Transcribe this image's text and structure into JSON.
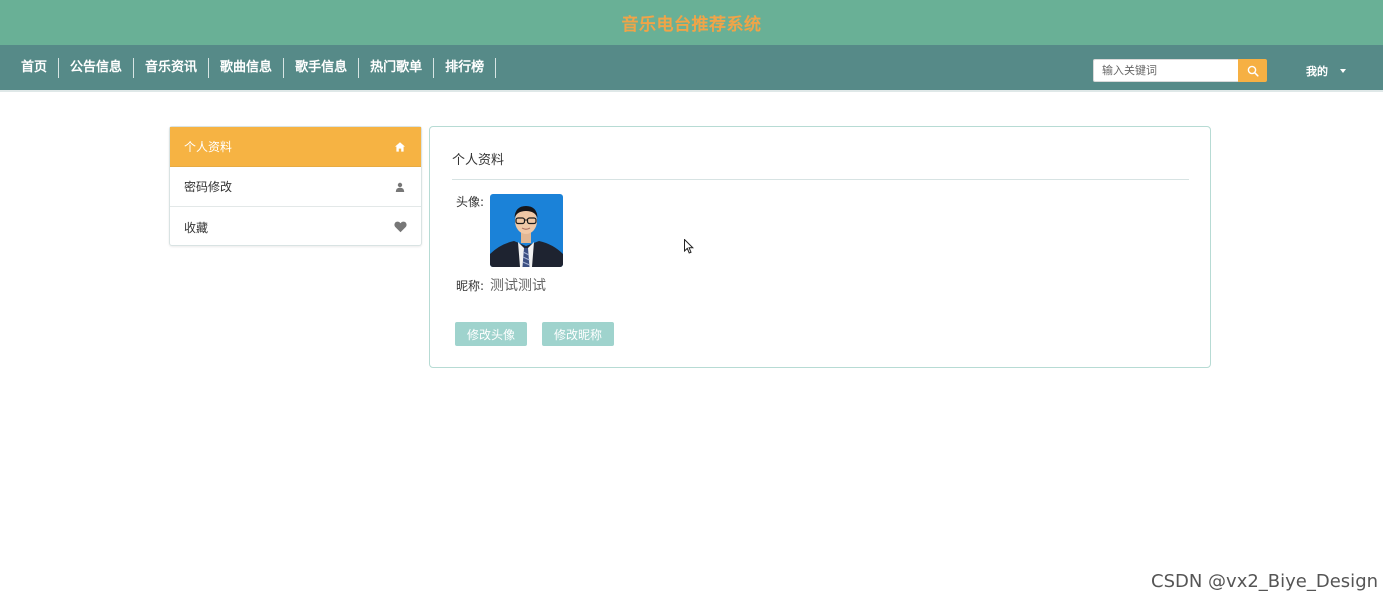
{
  "header": {
    "title": "音乐电台推荐系统",
    "title_color": "#f0a448",
    "bg_color": "#69b096"
  },
  "nav": {
    "items": [
      {
        "label": "首页"
      },
      {
        "label": "公告信息"
      },
      {
        "label": "音乐资讯"
      },
      {
        "label": "歌曲信息"
      },
      {
        "label": "歌手信息"
      },
      {
        "label": "热门歌单"
      },
      {
        "label": "排行榜"
      }
    ],
    "bg_color": "#568a88",
    "search_placeholder": "输入关键词",
    "search_icon": "search-icon",
    "user_menu_label": "我的"
  },
  "sidebar": {
    "items": [
      {
        "label": "个人资料",
        "icon": "home-icon",
        "active": true
      },
      {
        "label": "密码修改",
        "icon": "user-icon",
        "active": false
      },
      {
        "label": "收藏",
        "icon": "heart-icon",
        "active": false
      }
    ],
    "active_color": "#f6b343"
  },
  "profile": {
    "title": "个人资料",
    "avatar_label": "头像:",
    "nickname_label": "昵称:",
    "nickname_value": "测试测试",
    "edit_avatar_button": "修改头像",
    "edit_nickname_button": "修改昵称",
    "button_color": "#9fd3cd"
  },
  "watermark": "CSDN @vx2_Biye_Design"
}
